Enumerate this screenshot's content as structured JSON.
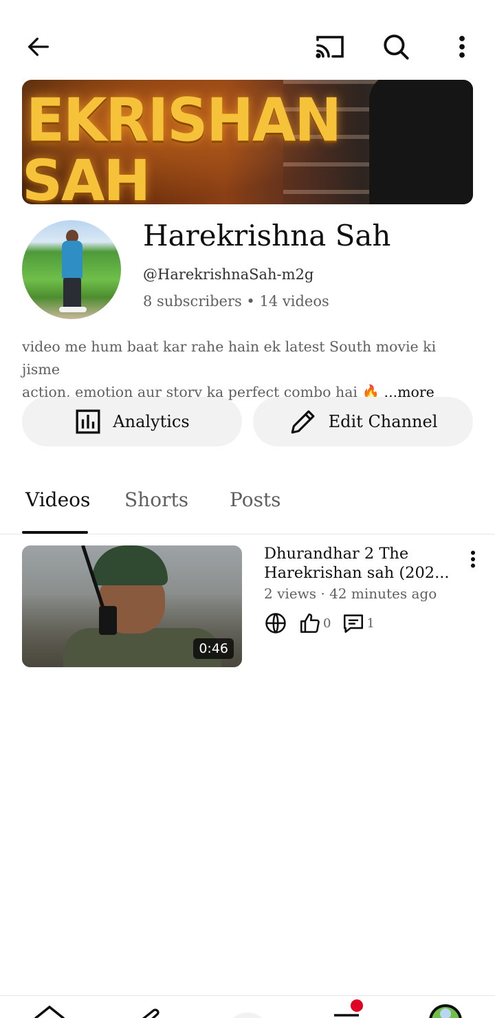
{
  "topbar": {
    "back_icon": "arrow-left-icon",
    "cast_icon": "cast-icon",
    "search_icon": "search-icon",
    "more_icon": "more-vertical-icon"
  },
  "banner": {
    "line1": "EKRISHAN",
    "line2": "SAH"
  },
  "channel": {
    "name": "Harekrishna Sah",
    "handle": "@HarekrishnaSah-m2g",
    "meta": "8 subscribers • 14 videos",
    "description_line1": "video me hum baat kar rahe hain ek latest South movie ki jisme",
    "description_line2": "action, emotion aur story ka perfect combo hai 🔥 ",
    "more_label": "...more"
  },
  "actions": {
    "analytics_label": "Analytics",
    "edit_label": "Edit Channel"
  },
  "tabs": [
    {
      "label": "Videos",
      "active": true
    },
    {
      "label": "Shorts",
      "active": false
    },
    {
      "label": "Posts",
      "active": false
    }
  ],
  "videos": [
    {
      "title_line1": "Dhurandhar 2 The",
      "title_line2": "Harekrishan sah (202...",
      "meta": "2 views · 42 minutes ago",
      "duration": "0:46",
      "likes": "0",
      "comments": "1",
      "visibility_icon": "globe-icon"
    }
  ],
  "bottom_nav": [
    "home-icon",
    "shorts-icon",
    "create-icon",
    "subscriptions-icon",
    "you-avatar"
  ],
  "colors": {
    "text_primary": "#0f0f0f",
    "text_secondary": "#606060",
    "pill_bg": "#f2f2f2",
    "notification_dot": "#e00022"
  }
}
